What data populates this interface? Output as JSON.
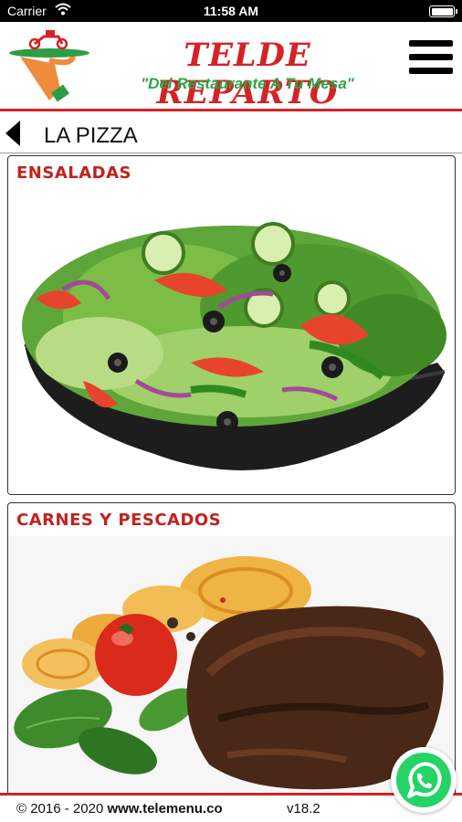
{
  "status_bar": {
    "carrier": "Carrier",
    "time": "11:58 AM"
  },
  "header": {
    "brand": "TELDE REPARTO",
    "tagline": "\"Del Restaurante A Tu Mesa\"",
    "icons": {
      "logo": "waiter-scooter-logo",
      "menu": "hamburger-menu-icon"
    }
  },
  "breadcrumb": {
    "title": "LA PIZZA",
    "back_icon": "back-arrow-icon"
  },
  "categories": [
    {
      "label": "ENSALADAS",
      "image": "salad-bowl-photo"
    },
    {
      "label": "CARNES Y PESCADOS",
      "image": "steak-pasta-photo"
    }
  ],
  "footer": {
    "copyright": "© 2016 - 2020 ",
    "site": "www.telemenu.co",
    "version": "v18.2"
  },
  "colors": {
    "brand_red": "#d52226",
    "tagline_green": "#28a745",
    "whatsapp_green": "#25d366"
  }
}
